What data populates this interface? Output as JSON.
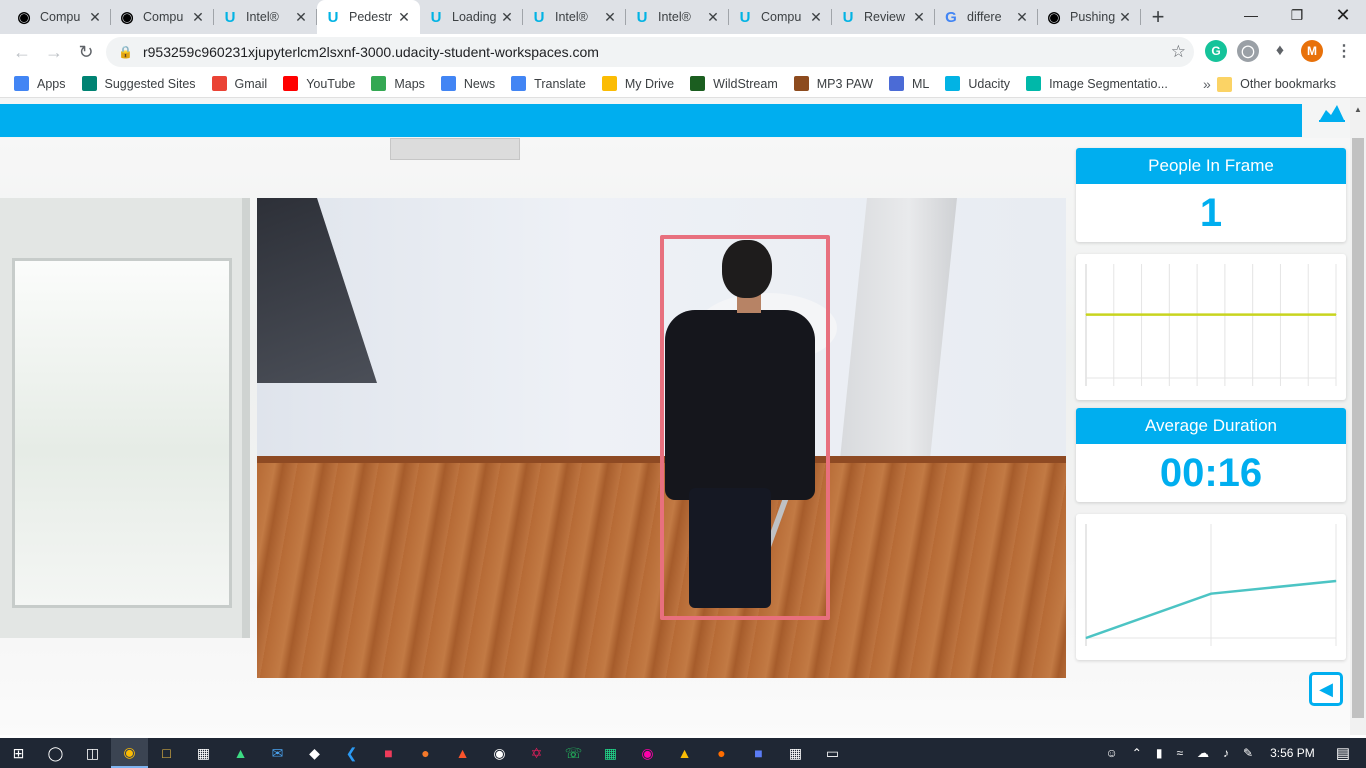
{
  "browser": {
    "tabs": [
      {
        "label": "Compu",
        "icon": "github-icon",
        "active": false
      },
      {
        "label": "Compu",
        "icon": "github-icon",
        "active": false
      },
      {
        "label": "Intel®",
        "icon": "udacity-icon",
        "active": false
      },
      {
        "label": "Pedestr",
        "icon": "udacity-icon",
        "active": true
      },
      {
        "label": "Loading",
        "icon": "udacity-icon",
        "active": false
      },
      {
        "label": "Intel®",
        "icon": "udacity-icon",
        "active": false
      },
      {
        "label": "Intel®",
        "icon": "udacity-icon",
        "active": false
      },
      {
        "label": "Compu",
        "icon": "udacity-icon",
        "active": false
      },
      {
        "label": "Review",
        "icon": "udacity-icon",
        "active": false
      },
      {
        "label": "differe",
        "icon": "google-icon",
        "active": false
      },
      {
        "label": "Pushing",
        "icon": "github-icon",
        "active": false
      }
    ],
    "url": "r953259c960231xjupyterlcm2lsxnf-3000.udacity-student-workspaces.com",
    "profile_initial": "M",
    "bookmarks": [
      {
        "label": "Apps",
        "icon": "apps-grid-icon",
        "color": "#4285f4"
      },
      {
        "label": "Suggested Sites",
        "icon": "bing-icon",
        "color": "#008373"
      },
      {
        "label": "Gmail",
        "icon": "gmail-icon",
        "color": "#ea4335"
      },
      {
        "label": "YouTube",
        "icon": "youtube-icon",
        "color": "#ff0000"
      },
      {
        "label": "Maps",
        "icon": "maps-icon",
        "color": "#34a853"
      },
      {
        "label": "News",
        "icon": "news-icon",
        "color": "#4285f4"
      },
      {
        "label": "Translate",
        "icon": "translate-icon",
        "color": "#4285f4"
      },
      {
        "label": "My Drive",
        "icon": "drive-icon",
        "color": "#fbbc04"
      },
      {
        "label": "WildStream",
        "icon": "wildstream-icon",
        "color": "#1b5e20"
      },
      {
        "label": "MP3 PAW",
        "icon": "paw-icon",
        "color": "#8d4b1e"
      },
      {
        "label": "ML",
        "icon": "link-icon",
        "color": "#4b6bd6"
      },
      {
        "label": "Udacity",
        "icon": "udacity-icon",
        "color": "#02b3e4"
      },
      {
        "label": "Image Segmentatio...",
        "icon": "link-icon",
        "color": "#00b8a9"
      }
    ],
    "other_bookmarks": "Other bookmarks"
  },
  "app": {
    "people_in_frame": {
      "title": "People In Frame",
      "value": "1"
    },
    "average_duration": {
      "title": "Average Duration",
      "value": "00:16"
    }
  },
  "chart_data": [
    {
      "type": "line",
      "series": [
        {
          "values": [
            1,
            1,
            1,
            1,
            1,
            1,
            1,
            1,
            1,
            1
          ]
        }
      ],
      "color": "#c8d41f",
      "grid": true
    },
    {
      "type": "line",
      "series": [
        {
          "values": [
            0,
            0.7,
            0.9
          ]
        }
      ],
      "color": "#4cc4c4",
      "grid": true
    }
  ],
  "taskbar": {
    "time": "3:56 PM"
  }
}
